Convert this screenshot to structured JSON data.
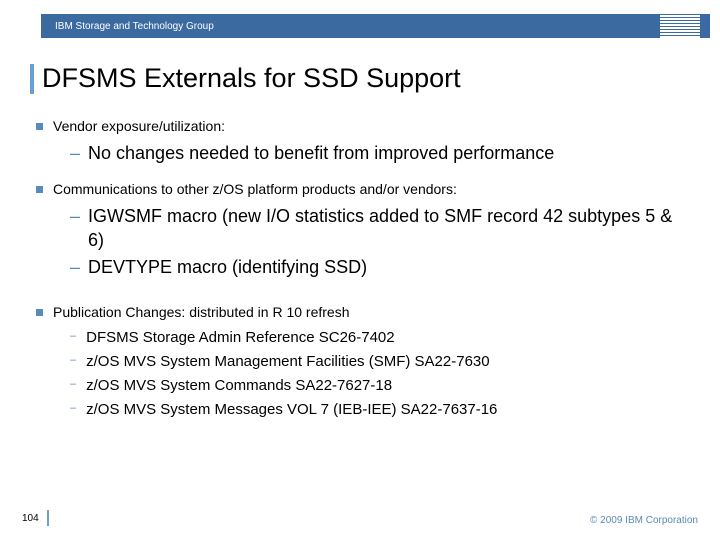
{
  "header": {
    "group": "IBM Storage and Technology Group",
    "logo_name": "ibm-logo"
  },
  "title": "DFSMS Externals for SSD Support",
  "bullets": [
    {
      "text": "Vendor exposure/utilization:",
      "subs_large": [
        "No changes needed to benefit from improved performance"
      ]
    },
    {
      "text": "Communications to other z/OS platform products and/or vendors:",
      "subs_large": [
        "IGWSMF macro  (new I/O statistics added to SMF record 42 subtypes 5 & 6)",
        "DEVTYPE macro (identifying SSD)"
      ]
    },
    {
      "text": "Publication Changes:  distributed in R 10 refresh",
      "subs_med": [
        "DFSMS Storage Admin Reference SC26-7402",
        "z/OS MVS System Management Facilities (SMF) SA22-7630",
        "z/OS MVS System Commands SA22-7627-18",
        "z/OS MVS System Messages VOL 7 (IEB-IEE) SA22-7637-16"
      ]
    }
  ],
  "footer": {
    "page": "104",
    "copyright": "© 2009 IBM Corporation"
  }
}
